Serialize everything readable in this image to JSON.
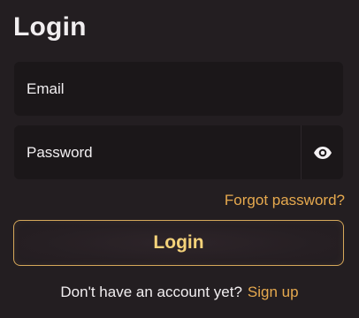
{
  "page": {
    "title": "Login"
  },
  "form": {
    "email": {
      "placeholder": "Email",
      "value": ""
    },
    "password": {
      "placeholder": "Password",
      "value": "",
      "toggle_icon": "eye-icon"
    },
    "forgot_label": "Forgot password?",
    "submit_label": "Login"
  },
  "footer": {
    "prompt": "Don't have an account yet?",
    "signup_label": "Sign up"
  },
  "colors": {
    "background": "#231e21",
    "field_background": "#1b1719",
    "accent": "#e6a94e",
    "button_border": "#d6a85a",
    "button_text": "#f4d27a",
    "text": "#f1eef0"
  }
}
